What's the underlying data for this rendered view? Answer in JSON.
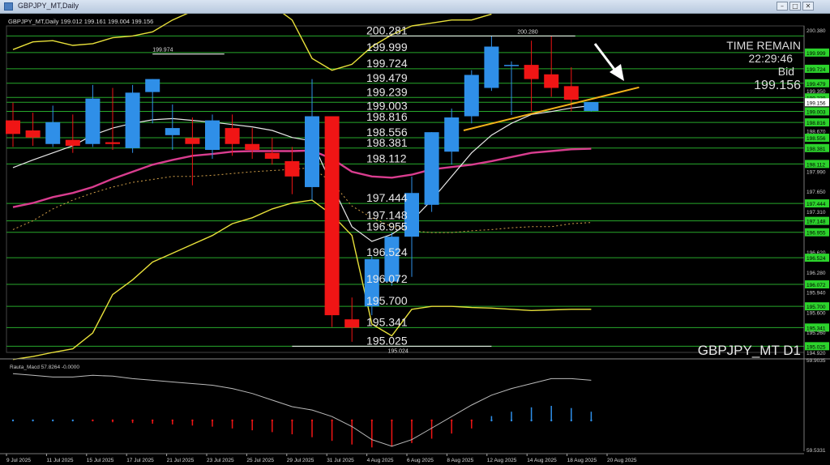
{
  "window": {
    "title": "GBPJPY_MT,Daily",
    "minimize_glyph": "–",
    "maximize_glyph": "□",
    "close_glyph": "✕"
  },
  "chart_header": "GBPJPY_MT,Daily  199.012 199.161 199.004 199.156",
  "symbol_label": "GBPJPY_MT D1",
  "info": {
    "time_remain_label": "TIME REMAIN",
    "time_remain_value": "22:29:46",
    "bid_label": "Bid",
    "bid_value": "199.156"
  },
  "indicator_label": "Rauta_Macd 57.8264 -0.0000",
  "colors": {
    "bull": "#2f8fe8",
    "bear": "#f01515",
    "grid": "#27a82b",
    "scale_tag": "#2cd32c",
    "bb": "#e8e03a",
    "ma_pink": "#d93d8f",
    "ma_white": "#e8e8e8",
    "trend": "#f2b21a"
  },
  "chart_data": {
    "type": "candlestick",
    "ylim": [
      194.92,
      200.45
    ],
    "x_labels": [
      "9 Jul 2025",
      "11 Jul 2025",
      "15 Jul 2025",
      "17 Jul 2025",
      "21 Jul 2025",
      "23 Jul 2025",
      "25 Jul 2025",
      "29 Jul 2025",
      "31 Jul 2025",
      "4 Aug 2025",
      "6 Aug 2025",
      "8 Aug 2025",
      "12 Aug 2025",
      "14 Aug 2025",
      "18 Aug 2025",
      "20 Aug 2025"
    ],
    "price_scale": [
      "200.380",
      "199.999",
      "199.724",
      "199.479",
      "199.350",
      "199.239",
      "199.003",
      "198.816",
      "198.670",
      "198.556",
      "198.381",
      "198.112",
      "197.990",
      "197.650",
      "197.444",
      "197.310",
      "197.148",
      "196.955",
      "196.620",
      "196.524",
      "196.280",
      "196.072",
      "195.940",
      "195.700",
      "195.600",
      "195.341",
      "195.260",
      "195.025",
      "194.920"
    ],
    "highlighted_levels": [
      "200.281",
      "199.999",
      "199.724",
      "199.479",
      "199.239",
      "199.156",
      "199.003",
      "198.816",
      "198.556",
      "198.381",
      "198.112",
      "197.444",
      "197.148",
      "196.955",
      "196.524",
      "196.072",
      "195.700",
      "195.341",
      "195.025"
    ],
    "level_labels": [
      "200.281",
      "199.999",
      "199.724",
      "199.479",
      "199.239",
      "199.003",
      "198.816",
      "198.556",
      "198.381",
      "198.112",
      "197.444",
      "197.148",
      "196.955",
      "196.524",
      "196.072",
      "195.700",
      "195.341",
      "195.025"
    ],
    "annotations": [
      "199.974",
      "200.280",
      "195.024"
    ],
    "candles": [
      {
        "o": 198.85,
        "h": 199.15,
        "c": 198.62,
        "l": 198.4
      },
      {
        "o": 198.68,
        "h": 198.98,
        "c": 198.56,
        "l": 198.42
      },
      {
        "o": 198.45,
        "h": 199.1,
        "c": 198.82,
        "l": 198.4
      },
      {
        "o": 198.52,
        "h": 198.95,
        "c": 198.42,
        "l": 198.3
      },
      {
        "o": 198.45,
        "h": 199.45,
        "c": 199.22,
        "l": 198.4
      },
      {
        "o": 198.48,
        "h": 199.4,
        "c": 198.45,
        "l": 198.35
      },
      {
        "o": 198.38,
        "h": 199.45,
        "c": 199.32,
        "l": 198.3
      },
      {
        "o": 199.33,
        "h": 199.55,
        "c": 199.55,
        "l": 198.8
      },
      {
        "o": 198.6,
        "h": 199.12,
        "c": 198.72,
        "l": 198.35
      },
      {
        "o": 198.55,
        "h": 198.9,
        "c": 198.45,
        "l": 197.75
      },
      {
        "o": 198.35,
        "h": 198.95,
        "c": 198.85,
        "l": 198.2
      },
      {
        "o": 198.72,
        "h": 198.95,
        "c": 198.45,
        "l": 198.25
      },
      {
        "o": 198.45,
        "h": 198.72,
        "c": 198.35,
        "l": 198.2
      },
      {
        "o": 198.3,
        "h": 198.55,
        "c": 198.2,
        "l": 198.1
      },
      {
        "o": 198.16,
        "h": 198.4,
        "c": 197.9,
        "l": 197.6
      },
      {
        "o": 197.72,
        "h": 199.55,
        "c": 198.92,
        "l": 197.5
      },
      {
        "o": 198.92,
        "h": 198.92,
        "c": 195.55,
        "l": 195.35
      },
      {
        "o": 195.48,
        "h": 195.85,
        "c": 195.34,
        "l": 195.1
      },
      {
        "o": 195.7,
        "h": 196.55,
        "c": 196.5,
        "l": 195.55
      },
      {
        "o": 196.12,
        "h": 196.95,
        "c": 196.88,
        "l": 196.05
      },
      {
        "o": 196.88,
        "h": 197.9,
        "c": 197.62,
        "l": 196.2
      },
      {
        "o": 197.42,
        "h": 198.65,
        "c": 198.65,
        "l": 197.3
      },
      {
        "o": 198.32,
        "h": 199.05,
        "c": 198.9,
        "l": 198.1
      },
      {
        "o": 198.92,
        "h": 199.7,
        "c": 199.62,
        "l": 198.8
      },
      {
        "o": 199.4,
        "h": 200.28,
        "c": 200.1,
        "l": 199.35
      },
      {
        "o": 199.79,
        "h": 199.85,
        "c": 199.79,
        "l": 198.94
      },
      {
        "o": 199.79,
        "h": 200.2,
        "c": 199.55,
        "l": 199.0
      },
      {
        "o": 199.63,
        "h": 200.28,
        "c": 199.4,
        "l": 199.25
      },
      {
        "o": 199.43,
        "h": 199.75,
        "c": 199.2,
        "l": 199.0
      },
      {
        "o": 199.01,
        "h": 199.16,
        "c": 199.16,
        "l": 199.0
      }
    ],
    "ma_pink": [
      197.38,
      197.45,
      197.55,
      197.62,
      197.72,
      197.86,
      197.98,
      198.1,
      198.18,
      198.25,
      198.28,
      198.32,
      198.33,
      198.33,
      198.33,
      198.34,
      198.2,
      197.98,
      197.9,
      197.88,
      197.93,
      198.02,
      198.06,
      198.1,
      198.16,
      198.23,
      198.3,
      198.33,
      198.36,
      198.37
    ],
    "ma_white": [
      198.05,
      198.18,
      198.3,
      198.42,
      198.6,
      198.72,
      198.8,
      198.86,
      198.88,
      198.85,
      198.82,
      198.78,
      198.74,
      198.68,
      198.56,
      198.5,
      197.75,
      197.05,
      196.8,
      196.92,
      197.15,
      197.5,
      197.9,
      198.3,
      198.6,
      198.8,
      198.95,
      199.0,
      199.06,
      199.1
    ],
    "ma_dotted": [
      197.0,
      197.15,
      197.35,
      197.5,
      197.62,
      197.72,
      197.8,
      197.85,
      197.9,
      197.9,
      197.92,
      197.95,
      197.98,
      198.0,
      198.02,
      198.05,
      197.8,
      197.4,
      197.2,
      197.05,
      196.98,
      196.95,
      196.95,
      196.98,
      197.0,
      197.03,
      197.05,
      197.05,
      197.1,
      197.12
    ],
    "bb_upper": [
      200.05,
      200.18,
      200.2,
      200.12,
      200.15,
      200.25,
      200.28,
      200.35,
      200.55,
      200.7,
      200.9,
      201.0,
      200.9,
      200.8,
      200.55,
      199.9,
      199.7,
      199.8,
      200.1,
      200.3,
      200.45,
      200.5,
      200.55,
      200.55,
      200.65
    ],
    "bb_lower": [
      194.8,
      194.85,
      194.92,
      194.98,
      195.25,
      195.9,
      196.15,
      196.45,
      196.6,
      196.75,
      196.9,
      197.1,
      197.2,
      197.35,
      197.45,
      197.5,
      197.25,
      196.9,
      195.4,
      195.2,
      195.65,
      195.7,
      195.7,
      195.68,
      195.67,
      195.65,
      195.63,
      195.64,
      195.65,
      195.65
    ],
    "trendline": [
      [
        22.6,
        198.68
      ],
      [
        31.4,
        199.41
      ]
    ],
    "macd_main": [
      57.2,
      57.1,
      57.0,
      57.0,
      57.1,
      57.05,
      56.9,
      56.8,
      56.7,
      56.6,
      56.5,
      56.3,
      56.0,
      55.6,
      55.2,
      55.0,
      54.6,
      54.0,
      53.2,
      52.8,
      53.2,
      53.9,
      54.6,
      55.3,
      55.9,
      56.3,
      56.6,
      56.9,
      56.9,
      56.8
    ],
    "macd_hist": [
      0.0,
      0.0,
      0.0,
      0.0,
      -0.1,
      -0.25,
      -0.35,
      -0.45,
      -0.55,
      -0.7,
      -0.85,
      -1.1,
      -1.35,
      -1.6,
      -1.9,
      -2.3,
      -2.8,
      -3.3,
      -3.7,
      -3.6,
      -3.1,
      -2.5,
      -1.8,
      -1.1,
      0.6,
      1.2,
      1.8,
      2.0,
      1.7,
      1.2
    ],
    "macd_scale": [
      "59.9035",
      "59.5331"
    ]
  }
}
